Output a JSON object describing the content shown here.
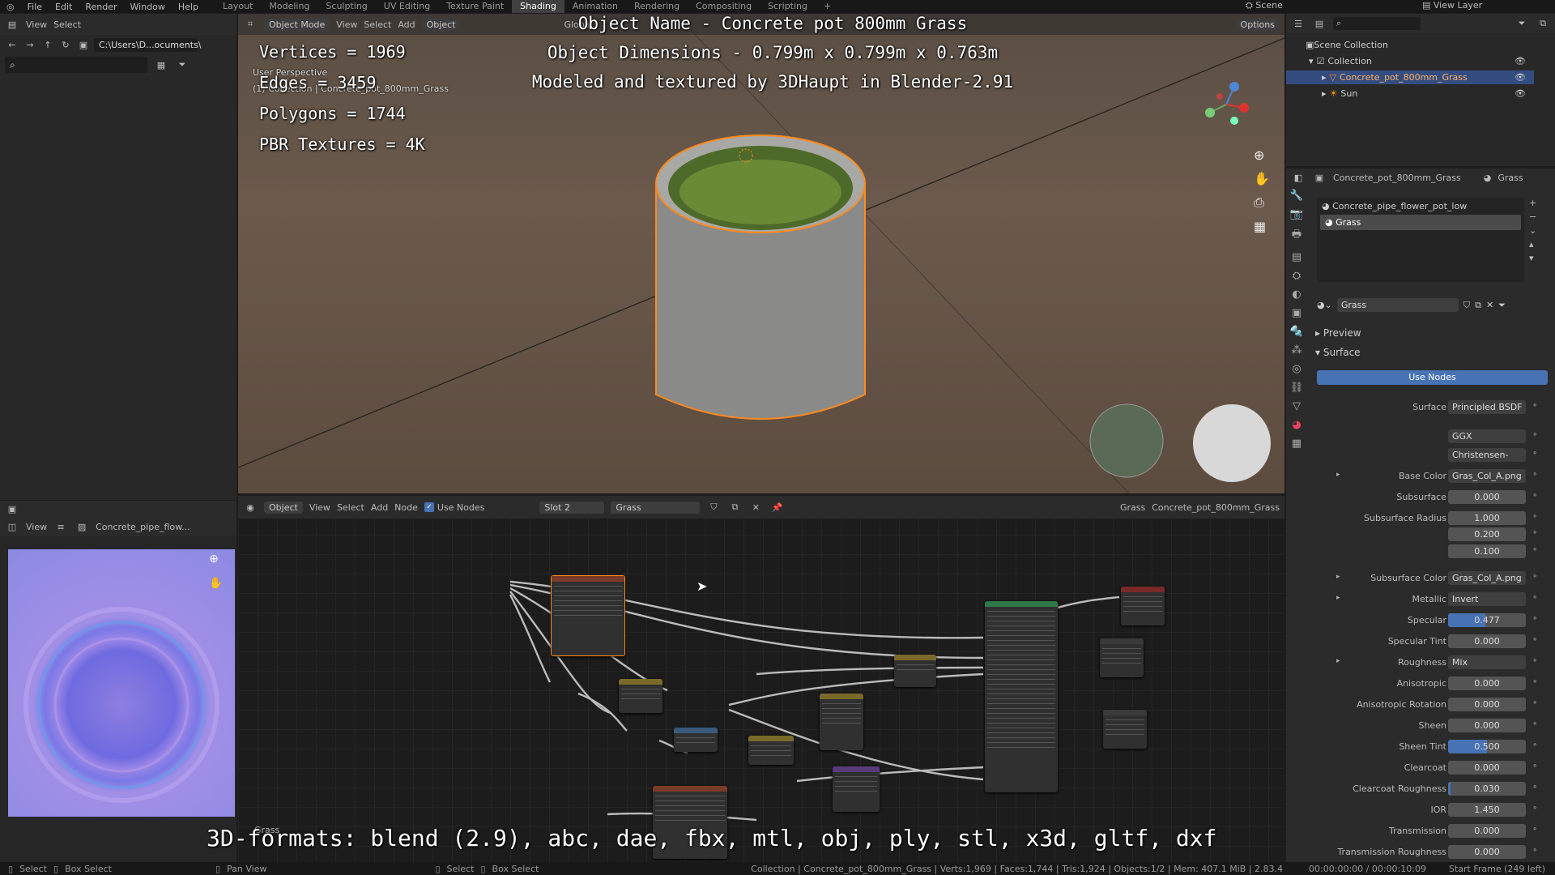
{
  "menu": {
    "blender_icon": "blender-logo-icon",
    "items": [
      "File",
      "Edit",
      "Render",
      "Window",
      "Help"
    ]
  },
  "workspaces": [
    "Layout",
    "Modeling",
    "Sculpting",
    "UV Editing",
    "Texture Paint",
    "Shading",
    "Animation",
    "Rendering",
    "Compositing",
    "Scripting",
    "+"
  ],
  "active_workspace": "Shading",
  "scene": {
    "label": "Scene",
    "view_layer": "View Layer"
  },
  "file_browser": {
    "view": "View",
    "select": "Select",
    "path": "C:\\Users\\D...ocuments\\"
  },
  "viewport": {
    "header": {
      "mode": "Object Mode",
      "view": "View",
      "select": "Select",
      "add": "Add",
      "object": "Object",
      "transform": "Global",
      "options": "Options"
    },
    "perspective_label": "User Perspective",
    "collection_label": "(1) Collection | Concrete_pot_800mm_Grass",
    "overlay_stats": [
      "Vertices = 1969",
      "Edges = 3459",
      "Polygons = 1744",
      "PBR Textures = 4K"
    ],
    "overlay_title": [
      "Object Name - Concrete pot 800mm Grass",
      "Object Dimensions -  0.799m x 0.799m x 0.763m",
      "Modeled and textured by 3DHaupt in Blender-2.91"
    ]
  },
  "image_editor": {
    "view": "View",
    "image_name": "Concrete_pipe_flow..."
  },
  "node_editor": {
    "mode": "Object",
    "view": "View",
    "select": "Select",
    "add": "Add",
    "node": "Node",
    "use_nodes": "Use Nodes",
    "slot": "Slot 2",
    "material": "Grass",
    "material2": "Grass",
    "object": "Concrete_pot_800mm_Grass",
    "footer_label": "Grass"
  },
  "bottom_banner": "3D-formats: blend (2.9), abc, dae, fbx, mtl, obj, ply, stl, x3d, gltf, dxf",
  "outliner": {
    "scene_collection": "Scene Collection",
    "collection": "Collection",
    "items": [
      {
        "name": "Concrete_pot_800mm_Grass",
        "selected": true
      },
      {
        "name": "Sun",
        "selected": false
      }
    ]
  },
  "properties": {
    "header_object": "Concrete_pot_800mm_Grass",
    "header_material": "Grass",
    "slots": [
      "Concrete_pipe_flower_pot_low",
      "Grass"
    ],
    "material_name": "Grass",
    "panels": {
      "preview": "Preview",
      "surface": "Surface"
    },
    "use_nodes": "Use Nodes",
    "rows": [
      {
        "label": "Surface",
        "value": "Principled BSDF",
        "kind": "text"
      },
      {
        "label": "",
        "value": "GGX",
        "kind": "text"
      },
      {
        "label": "",
        "value": "Christensen-Burley",
        "kind": "text"
      },
      {
        "label": "Base Color",
        "value": "Gras_Col_A.png",
        "kind": "link"
      },
      {
        "label": "Subsurface",
        "value": "0.000",
        "kind": "num",
        "fill": 0
      },
      {
        "label": "Subsurface Radius",
        "value": "1.000",
        "kind": "num",
        "fill": 0
      },
      {
        "label": "",
        "value": "0.200",
        "kind": "num",
        "fill": 0
      },
      {
        "label": "",
        "value": "0.100",
        "kind": "num",
        "fill": 0
      },
      {
        "label": "Subsurface Color",
        "value": "Gras_Col_A.png",
        "kind": "link"
      },
      {
        "label": "Metallic",
        "value": "Invert",
        "kind": "link"
      },
      {
        "label": "Specular",
        "value": "0.477",
        "kind": "num",
        "fill": 0.477
      },
      {
        "label": "Specular Tint",
        "value": "0.000",
        "kind": "num",
        "fill": 0
      },
      {
        "label": "Roughness",
        "value": "Mix",
        "kind": "link"
      },
      {
        "label": "Anisotropic",
        "value": "0.000",
        "kind": "num",
        "fill": 0
      },
      {
        "label": "Anisotropic Rotation",
        "value": "0.000",
        "kind": "num",
        "fill": 0
      },
      {
        "label": "Sheen",
        "value": "0.000",
        "kind": "num",
        "fill": 0
      },
      {
        "label": "Sheen Tint",
        "value": "0.500",
        "kind": "num",
        "fill": 0.5
      },
      {
        "label": "Clearcoat",
        "value": "0.000",
        "kind": "num",
        "fill": 0
      },
      {
        "label": "Clearcoat Roughness",
        "value": "0.030",
        "kind": "num",
        "fill": 0.03
      },
      {
        "label": "IOR",
        "value": "1.450",
        "kind": "num",
        "fill": 0
      },
      {
        "label": "Transmission",
        "value": "0.000",
        "kind": "num",
        "fill": 0
      },
      {
        "label": "Transmission Roughness",
        "value": "0.000",
        "kind": "num",
        "fill": 0
      }
    ]
  },
  "status": {
    "select": "Select",
    "box_select": "Box Select",
    "pan_view": "Pan View",
    "select2": "Select",
    "box_select2": "Box Select",
    "info": "Collection | Concrete_pot_800mm_Grass | Verts:1,969 | Faces:1,744 | Tris:1,924 | Objects:1/2 | Mem: 407.1 MiB | 2.83.4",
    "time": "00:00:00:00 / 00:00:10:09",
    "frame": "Start Frame (249 left)"
  },
  "colors": {
    "accent": "#4772b3",
    "selection": "#ff8a1f",
    "panel": "#2b2b2b",
    "node_grid": "#1c1c1c"
  }
}
